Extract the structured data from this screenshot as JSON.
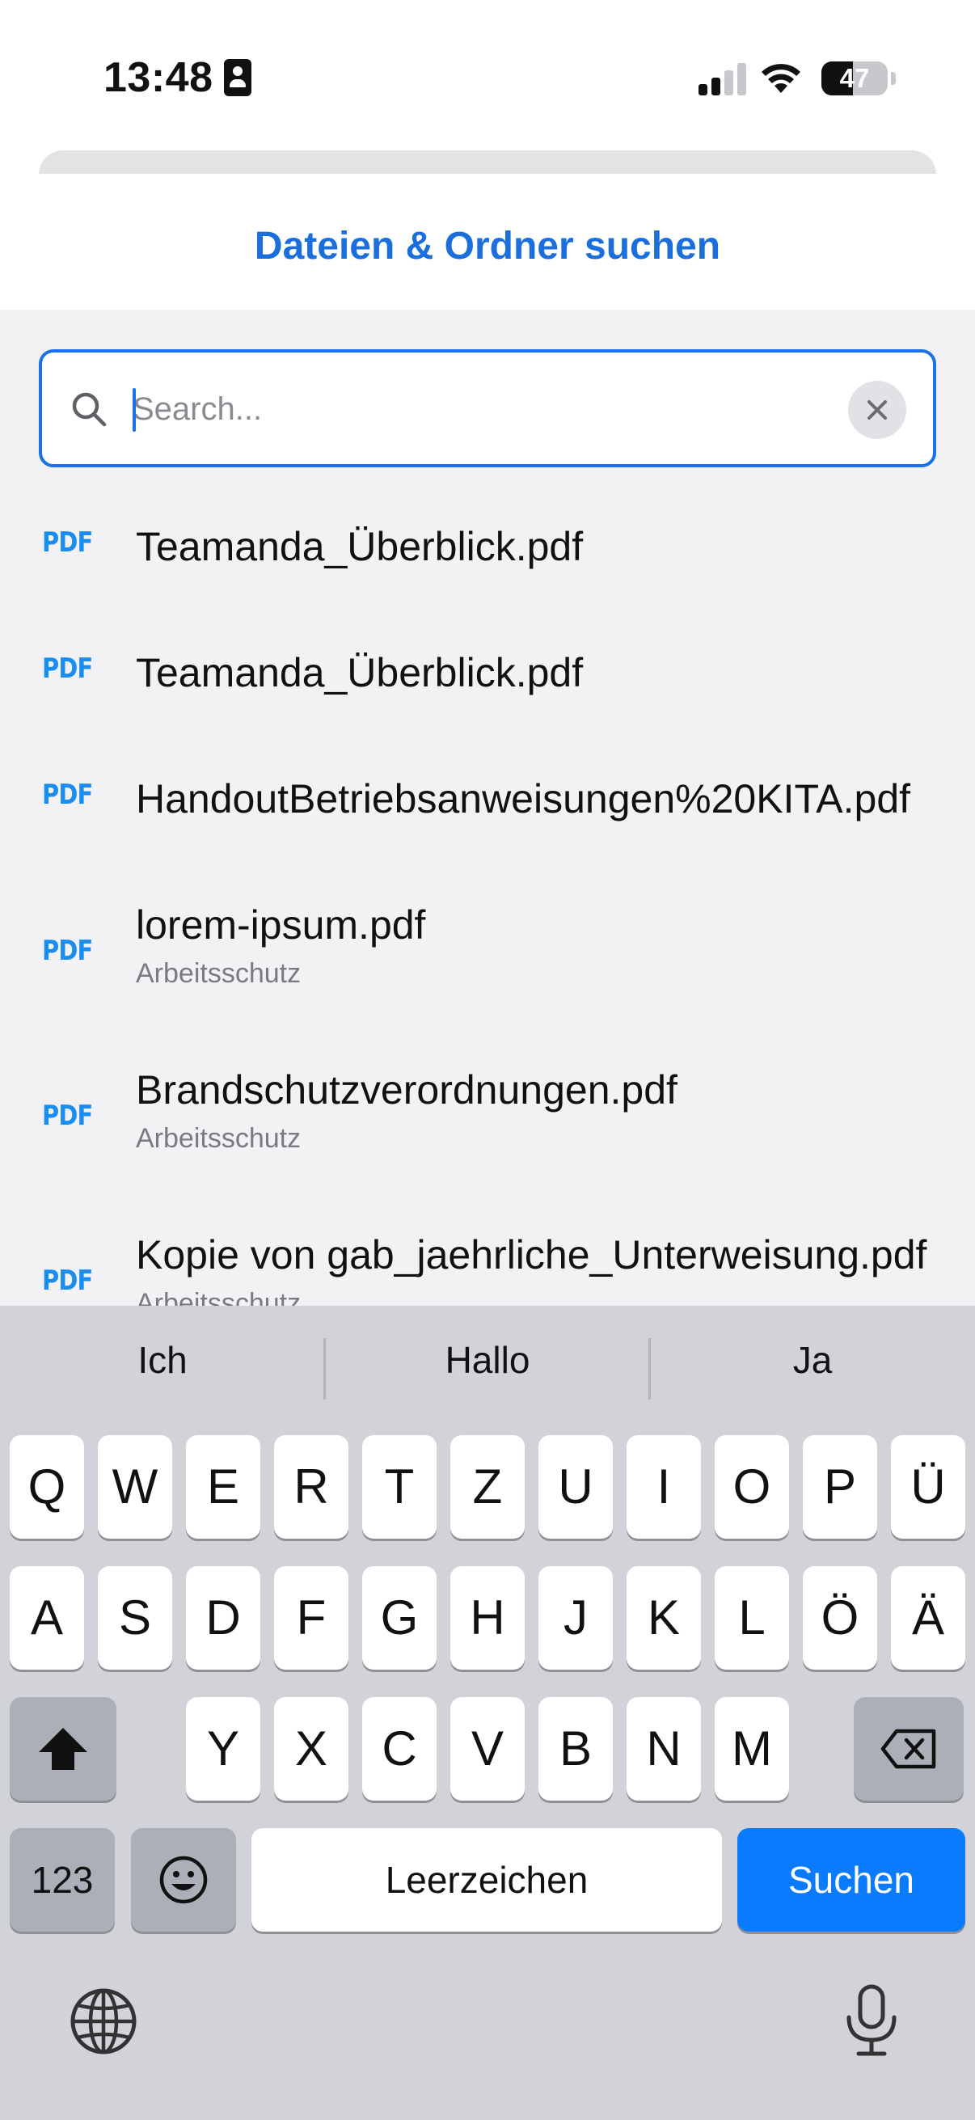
{
  "status_bar": {
    "time": "13:48",
    "battery": "47",
    "battery_level_percent": 47,
    "signal_bars_active": 2,
    "signal_bars_total": 4
  },
  "sheet": {
    "title": "Dateien & Ordner suchen"
  },
  "search": {
    "placeholder": "Search...",
    "value": ""
  },
  "results": [
    {
      "type": "PDF",
      "name": "Teamanda_Überblick.pdf",
      "folder": ""
    },
    {
      "type": "PDF",
      "name": "Teamanda_Überblick.pdf",
      "folder": ""
    },
    {
      "type": "PDF",
      "name": "HandoutBetriebsanweisungen%20KITA.pdf",
      "folder": ""
    },
    {
      "type": "PDF",
      "name": "lorem-ipsum.pdf",
      "folder": "Arbeitsschutz"
    },
    {
      "type": "PDF",
      "name": "Brandschutzverordnungen.pdf",
      "folder": "Arbeitsschutz"
    },
    {
      "type": "PDF",
      "name": "Kopie von gab_jaehrliche_Unterweisung.pdf",
      "folder": "Arbeitsschutz"
    }
  ],
  "keyboard": {
    "predictions": [
      "Ich",
      "Hallo",
      "Ja"
    ],
    "row1": [
      "Q",
      "W",
      "E",
      "R",
      "T",
      "Z",
      "U",
      "I",
      "O",
      "P",
      "Ü"
    ],
    "row2": [
      "A",
      "S",
      "D",
      "F",
      "G",
      "H",
      "J",
      "K",
      "L",
      "Ö",
      "Ä"
    ],
    "row3": [
      "Y",
      "X",
      "C",
      "V",
      "B",
      "N",
      "M"
    ],
    "numbers_label": "123",
    "space_label": "Leerzeichen",
    "action_label": "Suchen"
  },
  "colors": {
    "accent": "#1a72e6",
    "title": "#1a6fdc",
    "pdf_badge": "#1a8ef0",
    "action_key": "#0a7aff",
    "list_background": "#f2f2f4",
    "keyboard_background": "#d1d3d9"
  },
  "icons": {
    "search": "search-icon",
    "clear": "close-icon",
    "shift": "shift-icon",
    "backspace": "backspace-icon",
    "emoji": "emoji-icon",
    "globe": "globe-icon",
    "mic": "microphone-icon",
    "wifi": "wifi-icon",
    "contact_card": "contact-card-icon"
  }
}
